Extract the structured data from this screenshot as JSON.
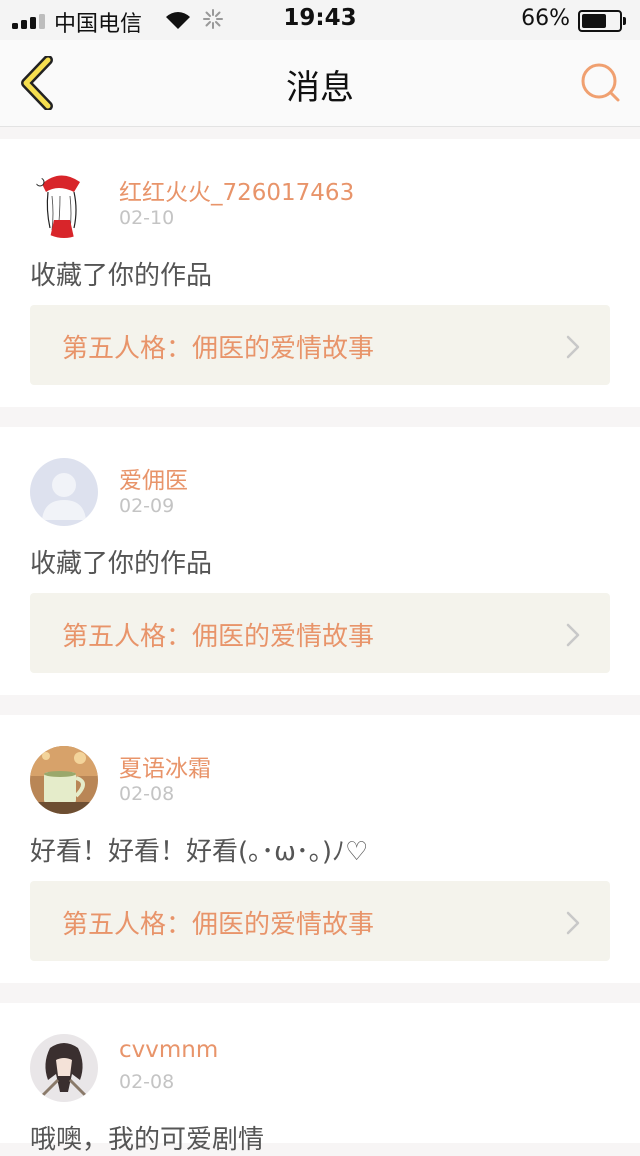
{
  "status_bar": {
    "carrier": "中国电信",
    "time": "19:43",
    "battery_percent": "66%",
    "battery_level": 0.66,
    "signal_bars": 3,
    "signal_bars_max": 4
  },
  "nav": {
    "title": "消息",
    "back_icon": "chevron-left-icon",
    "search_icon": "search-icon"
  },
  "colors": {
    "accent": "#e8946a",
    "date_gray": "#c4c4c4",
    "link_bg": "#f4f3ec",
    "back_icon_fill": "#f5de50",
    "search_icon_stroke": "#f0a070"
  },
  "messages": [
    {
      "user": "红红火火_726017463",
      "date": "02-10",
      "text": "收藏了你的作品",
      "work": "第五人格：佣医的爱情故事",
      "avatar": "sketch-girl-red-hat"
    },
    {
      "user": "爱佣医",
      "date": "02-09",
      "text": "收藏了你的作品",
      "work": "第五人格：佣医的爱情故事",
      "avatar": "default-person"
    },
    {
      "user": "夏语冰霜",
      "date": "02-08",
      "text": "好看！好看！好看(｡･ω･｡)ﾉ♡",
      "work": "第五人格：佣医的爱情故事",
      "avatar": "mug-photo"
    },
    {
      "user": "cvvmnm",
      "date": "02-08",
      "text": "哦噢，我的可爱剧情",
      "avatar": "anime-character"
    }
  ]
}
